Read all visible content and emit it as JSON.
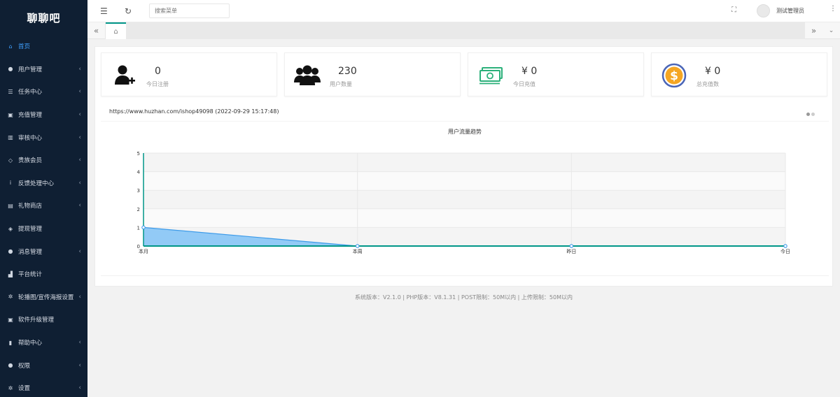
{
  "app": {
    "logo": "聊聊吧"
  },
  "sidebar": {
    "items": [
      {
        "label": "首页",
        "icon": "home-icon",
        "glyph": "⌂",
        "has_arrow": false,
        "active": true
      },
      {
        "label": "用户管理",
        "icon": "user-icon",
        "glyph": "●",
        "has_arrow": true
      },
      {
        "label": "任务中心",
        "icon": "list-icon",
        "glyph": "☰",
        "has_arrow": true
      },
      {
        "label": "充值管理",
        "icon": "gift-icon",
        "glyph": "▣",
        "has_arrow": true
      },
      {
        "label": "审核中心",
        "icon": "columns-icon",
        "glyph": "▥",
        "has_arrow": true
      },
      {
        "label": "贵族会员",
        "icon": "diamond-icon",
        "glyph": "◇",
        "has_arrow": true
      },
      {
        "label": "反馈处理中心",
        "icon": "info-icon",
        "glyph": "i",
        "has_arrow": true
      },
      {
        "label": "礼物商店",
        "icon": "store-icon",
        "glyph": "▤",
        "has_arrow": true
      },
      {
        "label": "提现管理",
        "icon": "wallet-icon",
        "glyph": "◈",
        "has_arrow": false
      },
      {
        "label": "消息管理",
        "icon": "chat-icon",
        "glyph": "●",
        "has_arrow": true
      },
      {
        "label": "平台统计",
        "icon": "stats-icon",
        "glyph": "▟",
        "has_arrow": false
      },
      {
        "label": "轮播图/宣传海报设置",
        "icon": "gear-icon",
        "glyph": "✲",
        "has_arrow": true
      },
      {
        "label": "软件升级管理",
        "icon": "box-icon",
        "glyph": "▣",
        "has_arrow": false
      },
      {
        "label": "帮助中心",
        "icon": "file-icon",
        "glyph": "▮",
        "has_arrow": true
      },
      {
        "label": "权限",
        "icon": "user-icon",
        "glyph": "●",
        "has_arrow": true
      },
      {
        "label": "设置",
        "icon": "gear-icon",
        "glyph": "✲",
        "has_arrow": true
      }
    ]
  },
  "header": {
    "search_placeholder": "搜索菜单",
    "username": "测试管理员"
  },
  "stats": [
    {
      "value": "0",
      "label": "今日注册",
      "icon": "user-add-icon"
    },
    {
      "value": "230",
      "label": "用户数量",
      "icon": "users-icon"
    },
    {
      "value": "¥ 0",
      "label": "今日充值",
      "icon": "money-icon"
    },
    {
      "value": "¥ 0",
      "label": "总充值数",
      "icon": "dollar-icon"
    }
  ],
  "info_line": "https://www.huzhan.com/ishop49098 (2022-09-29 15:17:48)",
  "chart_data": {
    "type": "area",
    "title": "用户流量趋势",
    "categories": [
      "本月",
      "本周",
      "昨日",
      "今日"
    ],
    "values": [
      1,
      0,
      0,
      0
    ],
    "ylim": [
      0,
      5
    ],
    "yticks": [
      0,
      1,
      2,
      3,
      4,
      5
    ],
    "grid": true,
    "colors": {
      "area": "#8cc7f5",
      "line": "#3d9be9",
      "axis": "#009688"
    }
  },
  "footer": "系统版本：V2.1.0   |   PHP版本：V8.1.31   |   POST限制：50M以内   |   上传限制：50M以内"
}
